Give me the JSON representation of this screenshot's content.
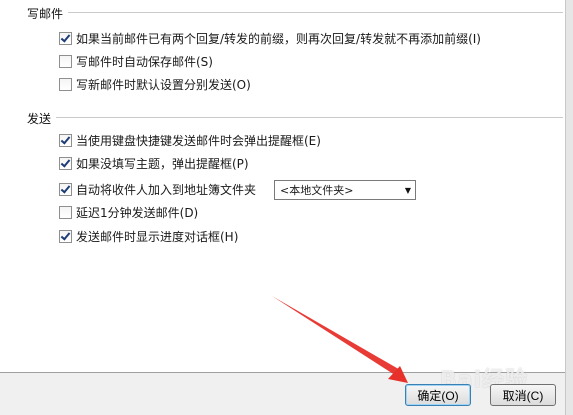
{
  "sections": {
    "compose": {
      "title": "写邮件",
      "options": [
        {
          "label": "如果当前邮件已有两个回复/转发的前缀，则再次回复/转发就不再添加前缀(I)",
          "checked": true
        },
        {
          "label": "写邮件时自动保存邮件(S)",
          "checked": false
        },
        {
          "label": "写新邮件时默认设置分别发送(O)",
          "checked": false
        }
      ]
    },
    "send": {
      "title": "发送",
      "options": [
        {
          "label": "当使用键盘快捷键发送邮件时会弹出提醒框(E)",
          "checked": true
        },
        {
          "label": "如果没填写主题，弹出提醒框(P)",
          "checked": true
        },
        {
          "label": "自动将收件人加入到地址簿文件夹",
          "checked": true
        },
        {
          "label": "延迟1分钟发送邮件(D)",
          "checked": false
        },
        {
          "label": "发送邮件时显示进度对话框(H)",
          "checked": true
        }
      ],
      "address_book_select": {
        "value": "<本地文件夹>"
      }
    }
  },
  "buttons": {
    "ok": "确定(O)",
    "cancel": "取消(C)"
  },
  "watermark": "Bai经验",
  "colors": {
    "arrow": "#e8302a",
    "ok_border": "#3c7fb1"
  }
}
